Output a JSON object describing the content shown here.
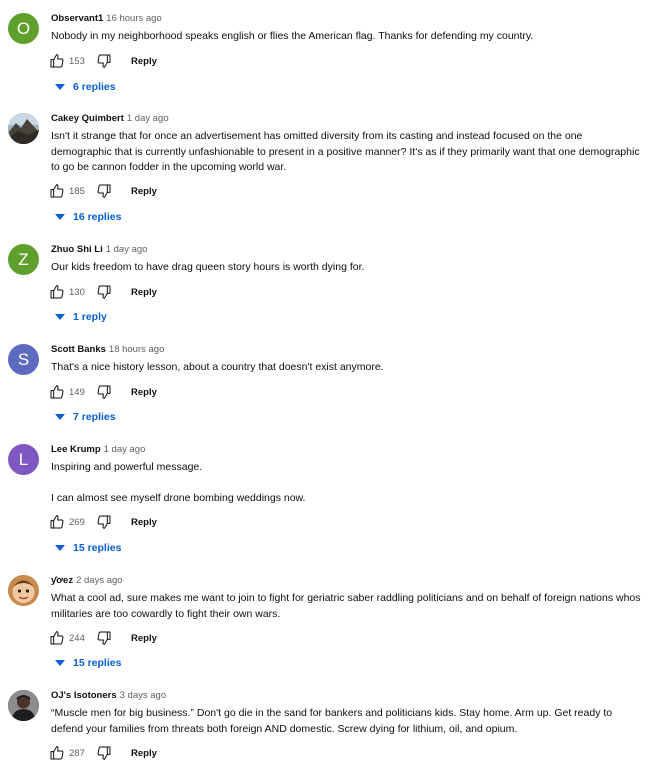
{
  "comments": [
    {
      "author": "Observant1",
      "time": "16 hours ago",
      "avatar": {
        "type": "letter",
        "letter": "O",
        "color": "#5fa02c"
      },
      "paragraphs": [
        "Nobody in my neighborhood speaks english or flies the American flag. Thanks for defending my country."
      ],
      "likes": "153",
      "reply_label": "Reply",
      "replies": "6 replies"
    },
    {
      "author": "Cakey Quimbert",
      "time": "1 day ago",
      "avatar": {
        "type": "image",
        "image": "mountain-photo"
      },
      "paragraphs": [
        "Isn't it strange that for once an advertisement has omitted diversity from its casting and instead focused on the one demographic that is currently unfashionable to present in a positive manner? It's as if they primarily want that one demographic to go be cannon fodder in the upcoming world war."
      ],
      "likes": "185",
      "reply_label": "Reply",
      "replies": "16 replies"
    },
    {
      "author": "Zhuo Shi Li",
      "time": "1 day ago",
      "avatar": {
        "type": "letter",
        "letter": "Z",
        "color": "#5fa02c"
      },
      "paragraphs": [
        "Our kids freedom to have drag queen story hours is worth dying for."
      ],
      "likes": "130",
      "reply_label": "Reply",
      "replies": "1 reply"
    },
    {
      "author": "Scott Banks",
      "time": "18 hours ago",
      "avatar": {
        "type": "letter",
        "letter": "S",
        "color": "#5c6bc0"
      },
      "paragraphs": [
        "That's a nice history lesson, about a country that doesn't exist anymore."
      ],
      "likes": "149",
      "reply_label": "Reply",
      "replies": "7 replies"
    },
    {
      "author": "Lee Krump",
      "time": "1 day ago",
      "avatar": {
        "type": "letter",
        "letter": "L",
        "color": "#7e57c2"
      },
      "paragraphs": [
        "Inspiring and powerful message.",
        "I can almost see myself drone bombing weddings now."
      ],
      "likes": "269",
      "reply_label": "Reply",
      "replies": "15 replies"
    },
    {
      "author": "ƴơez",
      "time": "2 days ago",
      "avatar": {
        "type": "image",
        "image": "cartoon-face"
      },
      "paragraphs": [
        "What a cool ad, sure makes me want to join to fight for geriatric saber raddling politicians and on behalf of foreign nations whos militaries are too cowardly to fight their own wars."
      ],
      "likes": "244",
      "reply_label": "Reply",
      "replies": "15 replies"
    },
    {
      "author": "OJ's Isotoners",
      "time": "3 days ago",
      "avatar": {
        "type": "image",
        "image": "person-photo"
      },
      "paragraphs": [
        "“Muscle men for big business.” Don't go die in the sand for bankers and politicians kids. Stay home. Arm up. Get ready to defend your families from threats both foreign AND domestic. Screw dying for lithium, oil, and opium."
      ],
      "likes": "287",
      "reply_label": "Reply",
      "replies": ""
    }
  ],
  "colors": {
    "link": "#065fd4",
    "secondary_text": "#606060"
  },
  "icons": {
    "like": "thumbs-up-icon",
    "dislike": "thumbs-down-icon",
    "expand": "caret-down-icon"
  }
}
